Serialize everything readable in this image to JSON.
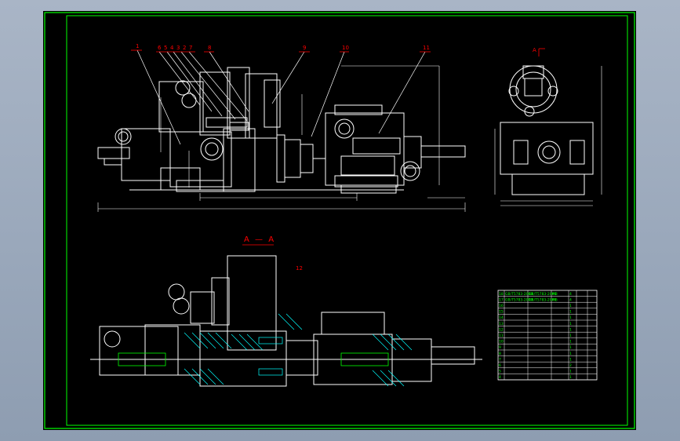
{
  "section_label": "A — A",
  "balloons": [
    "1",
    "6",
    "5",
    "4",
    "3",
    "2",
    "7",
    "8",
    "9",
    "10",
    "11",
    "12"
  ],
  "view_marker": "A",
  "colors": {
    "background": "#000000",
    "frame": "#00ff00",
    "outline": "#ffffff",
    "callout": "#ff0000",
    "hatch": "#00ffff",
    "dimension": "#ffffff"
  },
  "parts_list": {
    "rows": [
      [
        "18",
        "GB/T5783-2000",
        "GB/T5783-2000",
        "M8",
        "4",
        "",
        ""
      ],
      [
        "17",
        "GB/T5783-2000",
        "GB/T5783-2000",
        "M6",
        "4",
        "",
        ""
      ],
      [
        "16",
        "",
        "",
        "",
        "1",
        "",
        ""
      ],
      [
        "15",
        "",
        "",
        "",
        "1",
        "",
        ""
      ],
      [
        "14",
        "",
        "",
        "",
        "1",
        "",
        ""
      ],
      [
        "13",
        "",
        "",
        "",
        "1",
        "",
        ""
      ],
      [
        "12",
        "",
        "",
        "",
        "1",
        "",
        ""
      ],
      [
        "11",
        "",
        "",
        "",
        "1",
        "",
        ""
      ],
      [
        "10",
        "",
        "",
        "",
        "1",
        "",
        ""
      ],
      [
        "9",
        "",
        "",
        "",
        "1",
        "",
        ""
      ],
      [
        "8",
        "",
        "",
        "",
        "1",
        "",
        ""
      ],
      [
        "7",
        "",
        "",
        "",
        "1",
        "",
        ""
      ],
      [
        "6",
        "",
        "",
        "",
        "2",
        "",
        ""
      ],
      [
        "5",
        "",
        "",
        "",
        "1",
        "",
        ""
      ],
      [
        "4",
        "",
        "",
        "",
        "1",
        "",
        ""
      ]
    ]
  }
}
